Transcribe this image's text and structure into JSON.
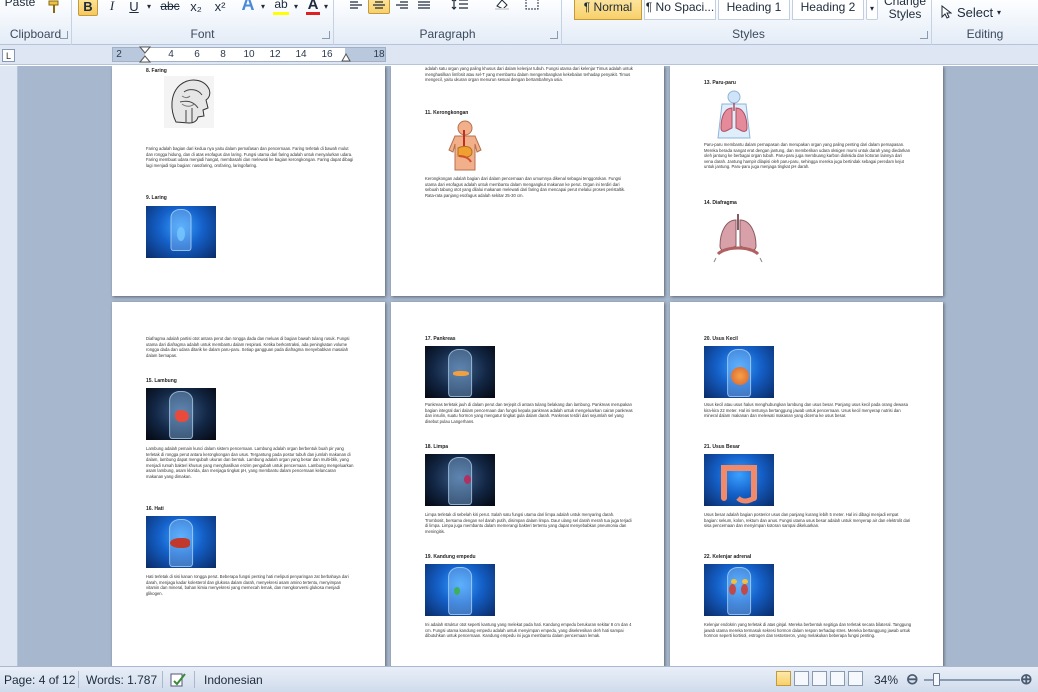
{
  "ribbon": {
    "clipboard": {
      "paste_label": "Paste",
      "group_label": "Clipboard"
    },
    "font": {
      "bold": "B",
      "italic": "I",
      "underline": "U",
      "strikethrough": "abc",
      "subscript": "x₂",
      "superscript": "x²",
      "text_effects": "A",
      "highlight": "ab",
      "font_color": "A",
      "group_label": "Font"
    },
    "paragraph": {
      "group_label": "Paragraph"
    },
    "styles": {
      "items": [
        "¶ Normal",
        "¶ No Spaci...",
        "Heading 1",
        "Heading 2"
      ],
      "selected": 0,
      "change_styles_label": "Change Styles",
      "group_label": "Styles"
    },
    "editing": {
      "select_label": "Select",
      "group_label": "Editing"
    }
  },
  "ruler": {
    "ticks": [
      "2",
      "2",
      "4",
      "6",
      "8",
      "10",
      "12",
      "14",
      "16",
      "18"
    ]
  },
  "document": {
    "pages": [
      {
        "blocks": [
          {
            "heading": "8.  Faring"
          },
          {
            "text": "Faring adalah bagian dari kedua nya yaitu dalam pernafasan dan pencernaan. Faring terletak di bawah mulut dan rongga hidung, dan di atas esofagus dan laring. Fungsi utama dari faring adalah untuk menyalurkan udara. Faring membuat udara menjadi hangat, membasahi dan melewati ke bagian kerongkongan. Faring dapat dibagi lagi menjadi tiga bagian: nasofaring, orofaring, laringofaring."
          },
          {
            "heading": "9.  Laring"
          }
        ]
      },
      {
        "blocks": [
          {
            "text": "adalah satu organ yang paling khusus dari dalam kelenjar tubuh. Fungsi utama dari kelenjar Timus adalah untuk menghasilkan limfosit atau sel-T yang membantu dalam mengembangkan kekebalan terhadap penyakit. Timus mengecil, yaitu ukuran organ menurun sesuai dengan bertambahnya usia."
          },
          {
            "heading": "11.  Kerongkongan"
          },
          {
            "text": "Kerongkongan adalah bagian dari dalam pencernaan dan umumnya dikenal sebagai tenggorokan. Fungsi utama dari esofagus adalah untuk membantu dalam mengangkut makanan ke perut. Organ ini terdiri dari sebuah tabung otot yang dilalui makanan melewati dari faring dan mencapai perut melalui proses peristaltik. Rata-rata panjang esofagus adalah sekitar 25-30 cm."
          }
        ]
      },
      {
        "blocks": [
          {
            "heading": "13.  Paru-paru"
          },
          {
            "text": "Paru-paru membantu dalam pernapasan dan merupakan organ yang paling penting dari dalam pernapasan. Mereka berada sangat erat dengan jantung, dan memberikan udara oksigen murni untuk darah yang diedarkan oleh jantung ke berbagai organ tubuh. Paru-paru juga membuang karbon dioksida dan kotoran lainnya dari vena darah. Jantung hampir dilapisi oleh paru-paru, sehingga mereka juga bertindak sebagai peredam kejut untuk jantung. Paru-paru juga menjaga tingkat pH darah."
          },
          {
            "heading": "14.  Diafragma"
          }
        ]
      },
      {
        "blocks": [
          {
            "text": "Diafragma adalah partisi otot antara perut dan rongga dada dan meluas di bagian bawah tulang rusuk. Fungsi utama dari diafragma adalah untuk membantu dalam respirasi. Ketika berkontraksi, ada peningkatan volume rongga dada dan udara ditarik ke dalam paru-paru. Setiap gangguan pada diafragma menyebabkan masalah dalam bernapas."
          },
          {
            "heading": "15.  Lambung"
          },
          {
            "text": "Lambung adalah pemain kunci dalam sistem pencernaan. Lambung adalah organ berbentuk buah pir yang terletak di rongga perut antara kerongkongan dan usus. Tergantung pada postur tubuh dan jumlah makanan di dalam, lambung dapat mengubah ukuran dan bentuk. Lambung adalah organ yang besar dan multi-blik, yang menjadi rumah bakteri khusus yang menghasilkan enzim pengubah untuk pencernaan. Lambung mengeluarkan asam lambung, asam klorida, dan menjaga tingkat pH, yang membantu dalam pencernaan kelancaran makanan yang dimakan."
          },
          {
            "heading": "16.  Hati"
          },
          {
            "text": "Hati terletak di sisi kanan rongga perut. Beberapa fungsi penting hati meliputi penyaringan zat berbahaya dari darah, menjaga kadar kolesterol dan glukosa dalam darah, menyekresi asam amino tertentu, menyimpan vitamin dan mineral, bahan kimia menyekresi yang memecah lemak, dan mengkonversi glukosa menjadi glikogen."
          }
        ]
      },
      {
        "blocks": [
          {
            "heading": "17.  Pankreas"
          },
          {
            "text": "Pankreas terletak jauh di dalam perut dan terjepit di antara tulang belakang dan lambung. Pankreas merupakan bagian integral dari dalam pencernaan dan fungsi kepala pankreas adalah untuk mengeluarkan cairan pankreas dan insulin, suatu hormon yang mengatur tingkat gula dalam darah. Pankreas terdiri dari sejumlah sel yang disebut pulau Langerhans."
          },
          {
            "heading": "18.  Limpa"
          },
          {
            "text": "Limpa terletak di sebelah kiri perut. Salah satu fungsi utama dari limpa adalah untuk menyaring darah. Trombosit, bersama dengan sel darah putih, disimpan dalam limpa. Daur ulang sel darah merah tua juga terjadi di limpa. Limpa juga membantu dalam memerangi bakteri tertentu yang dapat menyebabkan pneumonia dan meningitis."
          },
          {
            "heading": "19.  Kandung empedu"
          },
          {
            "text": "Ini adalah struktur otot seperti kantung yang melekat pada hati. Kandung empedu berukuran sekitar 8 cm dan 4 cm. Fungsi utama kandung empedu adalah untuk menyimpan empedu, yang disekresikan oleh hati sampai dibutuhkan untuk pencernaan. Kandung empedu ini juga membantu dalam pencernaan lemak."
          }
        ]
      },
      {
        "blocks": [
          {
            "heading": "20.  Usus Kecil"
          },
          {
            "text": "Usus kecil atau usus halus menghubungkan lambung dan usus besar. Panjang usus kecil pada orang dewasa kira-kira 22 meter. Hal ini tentunya bertanggung jawab untuk pencernaan. Usus kecil menyerap nutrisi dan mineral dalam makanan dan melewati makanan yang dicerna ke usus besar."
          },
          {
            "heading": "21.  Usus Besar"
          },
          {
            "text": "Usus besar adalah bagian posterior usus dan panjang kurang lebih 5 meter. Hal ini dibagi menjadi empat bagian: sekum, kolon, rektum dan anus. Fungsi utama usus besar adalah untuk menyerap air dan elektrolit dari sisa pencernaan dan menyimpan kotoran sampai dikeluarkan."
          },
          {
            "heading": "22.  Kelenjar adrenal"
          },
          {
            "text": "Kelenjar endokrin yang terletak di atas ginjal. Mereka berbentuk segitiga dan terletak secara bilateral. Tanggung jawab utama mereka termasuk sekresi hormon dalam respon terhadap stres. Mereka bertanggung jawab untuk hormon seperti kortisol, estrogen dan testosteron, yang melakukan beberapa fungsi penting."
          }
        ]
      }
    ]
  },
  "statusbar": {
    "page": "Page: 4 of 12",
    "words": "Words: 1.787",
    "language": "Indonesian",
    "zoom": "34%"
  }
}
